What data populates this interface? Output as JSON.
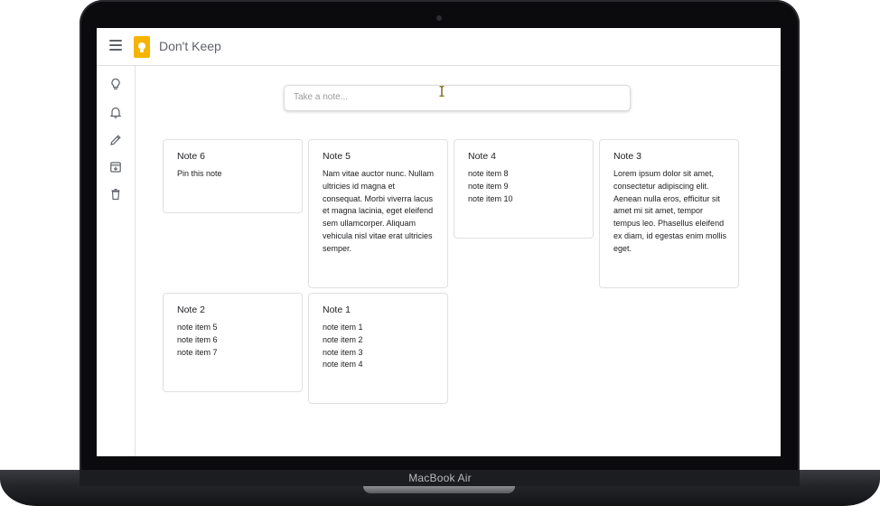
{
  "device": {
    "label": "MacBook Air"
  },
  "app": {
    "title": "Don't Keep",
    "logo_color": "#f6b400"
  },
  "header": {
    "menu_icon": "hamburger-menu-icon"
  },
  "sidebar": {
    "items": [
      {
        "icon": "lightbulb-icon",
        "name": "notes"
      },
      {
        "icon": "bell-icon",
        "name": "reminders"
      },
      {
        "icon": "pencil-icon",
        "name": "edit-labels"
      },
      {
        "icon": "archive-icon",
        "name": "archive"
      },
      {
        "icon": "trash-icon",
        "name": "trash"
      }
    ]
  },
  "search": {
    "placeholder": "Take a note...",
    "value": ""
  },
  "notes": [
    {
      "title": "Note 6",
      "body": "Pin this note"
    },
    {
      "title": "Note 5",
      "body": "Nam vitae auctor nunc. Nullam ultricies id magna et consequat. Morbi viverra lacus et magna lacinia, eget eleifend sem ullamcorper. Aliquam vehicula nisl vitae erat ultricies semper."
    },
    {
      "title": "Note 4",
      "items": [
        "note item 8",
        "note item 9",
        "note item 10"
      ]
    },
    {
      "title": "Note 3",
      "body": "Lorem ipsum dolor sit amet, consectetur adipiscing elit. Aenean nulla eros, efficitur sit amet mi sit amet, tempor tempus leo. Phasellus eleifend ex diam, id egestas enim mollis eget."
    },
    {
      "title": "Note 2",
      "items": [
        "note item 5",
        "note item 6",
        "note item 7"
      ]
    },
    {
      "title": "Note 1",
      "items": [
        "note item 1",
        "note item 2",
        "note item 3",
        "note item 4"
      ]
    }
  ]
}
